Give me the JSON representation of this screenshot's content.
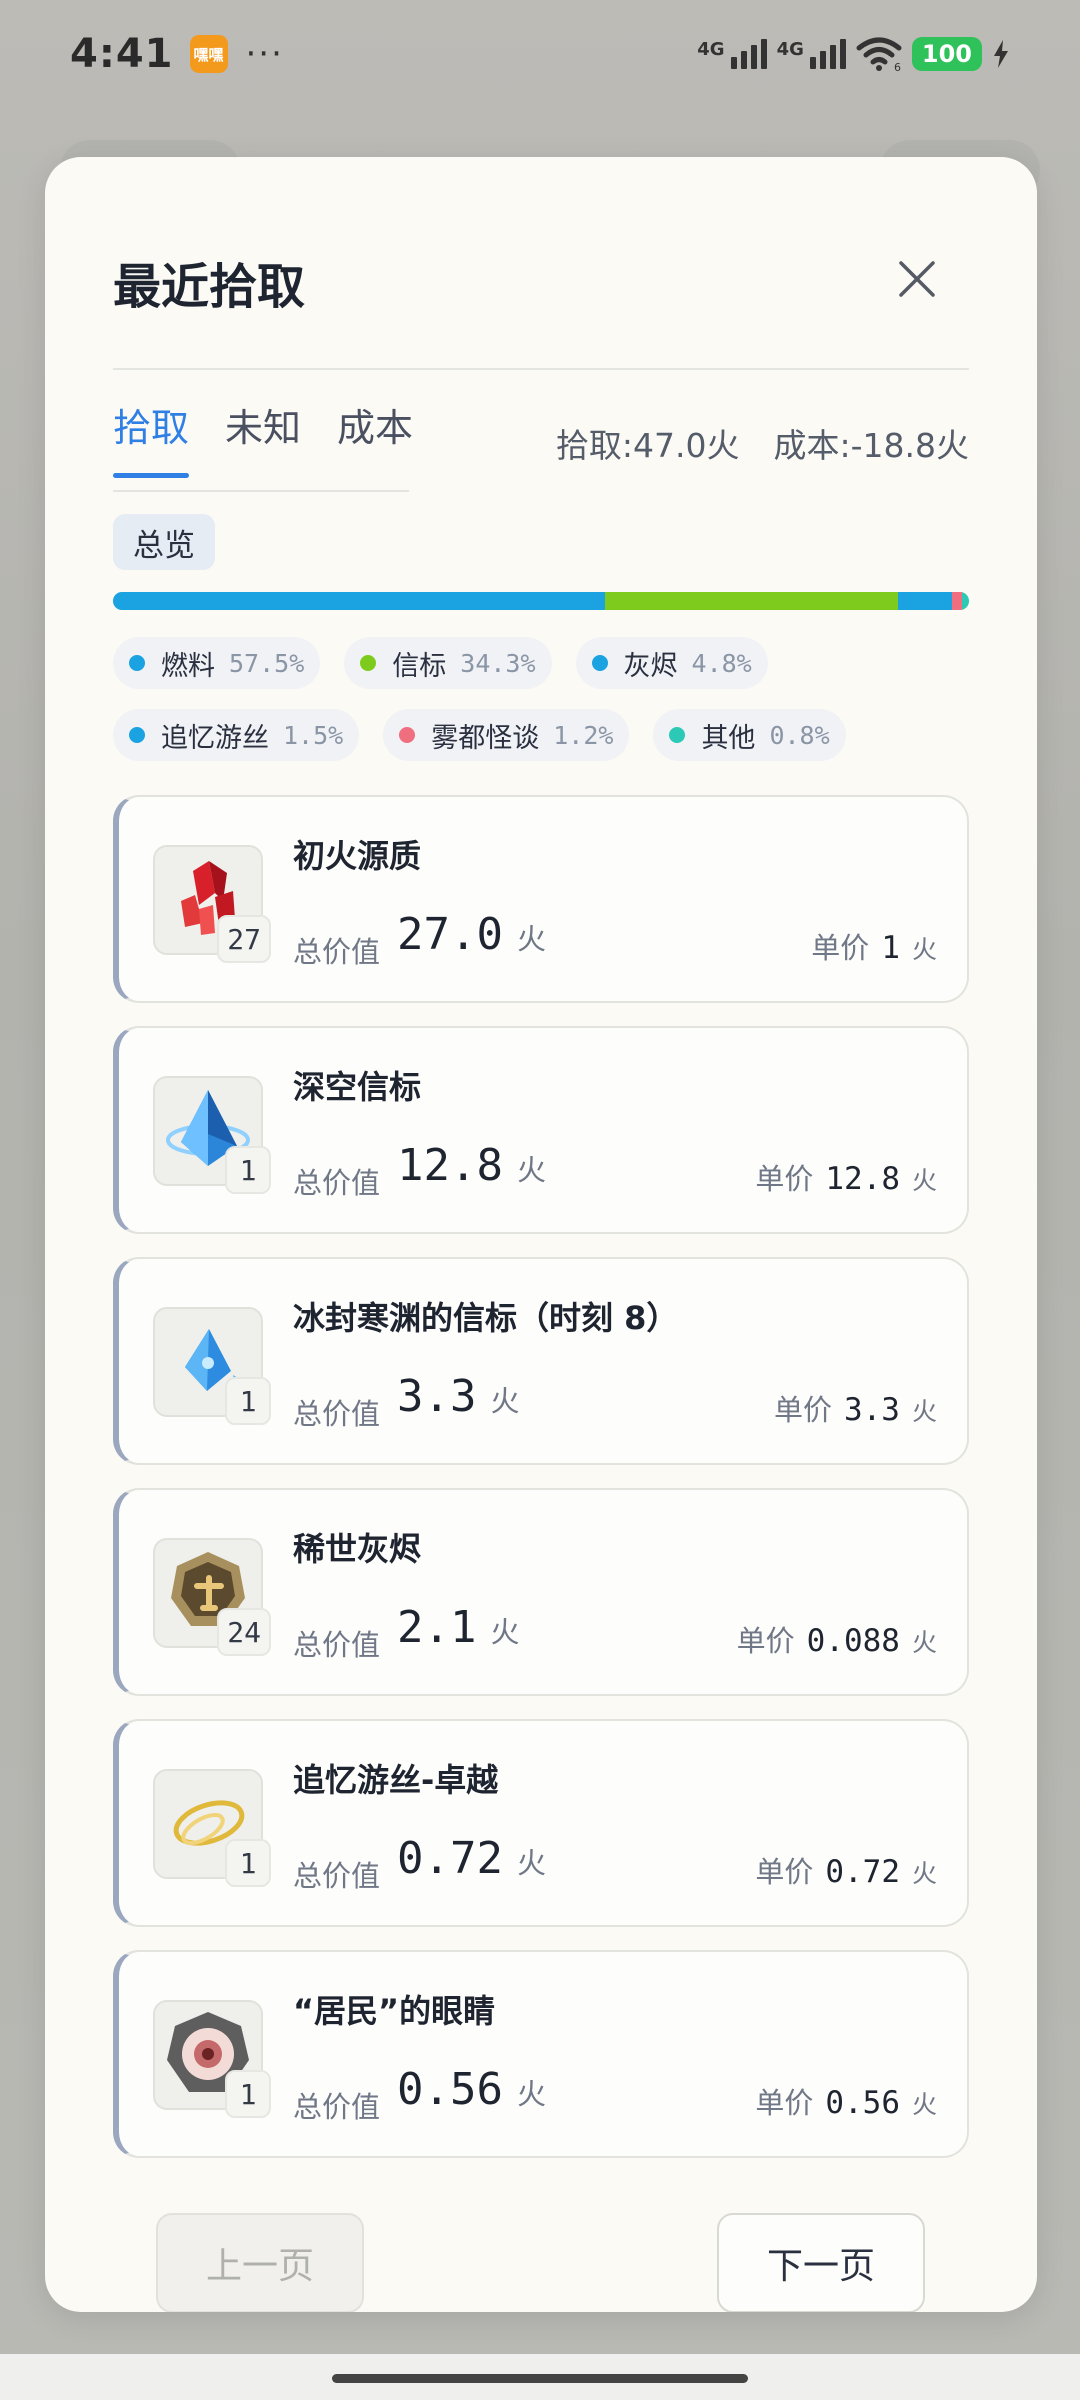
{
  "status_bar": {
    "time": "4:41",
    "app_badge": "嘿嘿",
    "dots": "···",
    "net1": "4G",
    "net2": "4G",
    "wifi_sub": "6",
    "battery": "100"
  },
  "modal": {
    "title": "最近拾取",
    "tabs": [
      {
        "label": "拾取",
        "active": true
      },
      {
        "label": "未知",
        "active": false
      },
      {
        "label": "成本",
        "active": false
      }
    ],
    "summary": {
      "pickup": "拾取:47.0火",
      "cost": "成本:-18.8火"
    },
    "overview_chip": "总览",
    "colors": {
      "accent": "#2f7fe4",
      "fuel": "#1aa3e0",
      "beacon": "#7ecb1e",
      "ash": "#1aa3e0",
      "silk": "#1aa3e0",
      "fog": "#ef6f7f",
      "other": "#2cc9b6"
    },
    "breakdown": [
      {
        "name": "燃料",
        "pct": "57.5%",
        "value": 57.5,
        "color": "#1aa3e0"
      },
      {
        "name": "信标",
        "pct": "34.3%",
        "value": 34.3,
        "color": "#7ecb1e"
      },
      {
        "name": "灰烬",
        "pct": "4.8%",
        "value": 4.8,
        "color": "#1aa3e0"
      },
      {
        "name": "追忆游丝",
        "pct": "1.5%",
        "value": 1.5,
        "color": "#1aa3e0"
      },
      {
        "name": "雾都怪谈",
        "pct": "1.2%",
        "value": 1.2,
        "color": "#ef6f7f"
      },
      {
        "name": "其他",
        "pct": "0.8%",
        "value": 0.8,
        "color": "#2cc9b6"
      }
    ],
    "items": [
      {
        "name": "初火源质",
        "qty": "27",
        "total_label": "总价值",
        "total": "27.0",
        "unit": "火",
        "price_label": "单价",
        "price": "1",
        "icon": "red-crystal-icon"
      },
      {
        "name": "深空信标",
        "qty": "1",
        "total_label": "总价值",
        "total": "12.8",
        "unit": "火",
        "price_label": "单价",
        "price": "12.8",
        "icon": "blue-prism-icon"
      },
      {
        "name": "冰封寒渊的信标（时刻 8）",
        "qty": "1",
        "total_label": "总价值",
        "total": "3.3",
        "unit": "火",
        "price_label": "单价",
        "price": "3.3",
        "icon": "ice-beacon-icon"
      },
      {
        "name": "稀世灰烬",
        "qty": "24",
        "total_label": "总价值",
        "total": "2.1",
        "unit": "火",
        "price_label": "单价",
        "price": "0.088",
        "icon": "gold-medal-icon"
      },
      {
        "name": "追忆游丝-卓越",
        "qty": "1",
        "total_label": "总价值",
        "total": "0.72",
        "unit": "火",
        "price_label": "单价",
        "price": "0.72",
        "icon": "golden-thread-icon"
      },
      {
        "name": "“居民”的眼睛",
        "qty": "1",
        "total_label": "总价值",
        "total": "0.56",
        "unit": "火",
        "price_label": "单价",
        "price": "0.56",
        "icon": "eye-orb-icon"
      }
    ],
    "pager": {
      "prev": "上一页",
      "next": "下一页"
    }
  }
}
